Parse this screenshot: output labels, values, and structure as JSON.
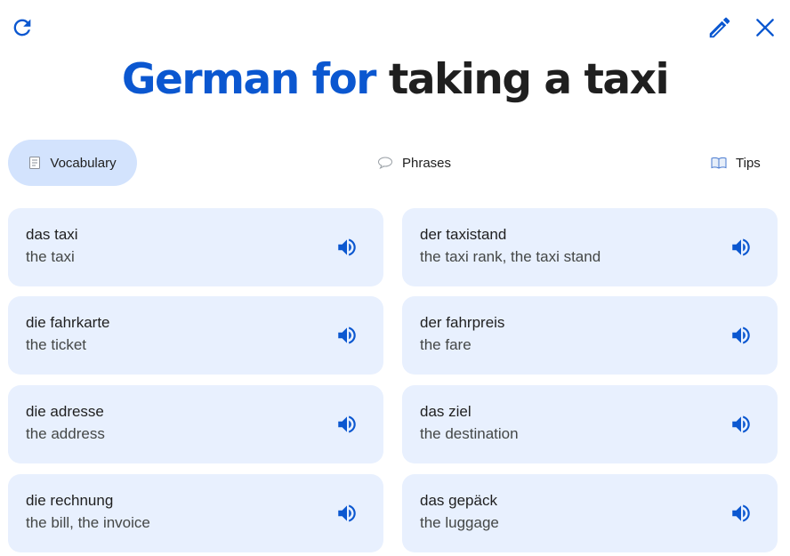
{
  "toolbar": {
    "refresh_icon": "refresh-icon",
    "edit_icon": "pencil-icon",
    "close_icon": "close-icon"
  },
  "title": {
    "accent": "German for",
    "rest": "taking a taxi"
  },
  "tabs": [
    {
      "label": "Vocabulary",
      "icon": "notepad-icon",
      "selected": true
    },
    {
      "label": "Phrases",
      "icon": "speech-bubble-icon",
      "selected": false
    },
    {
      "label": "Tips",
      "icon": "book-icon",
      "selected": false
    }
  ],
  "vocabulary": [
    {
      "word": "das taxi",
      "meaning": "the taxi"
    },
    {
      "word": "der taxistand",
      "meaning": "the taxi rank, the taxi stand"
    },
    {
      "word": "die fahrkarte",
      "meaning": "the ticket"
    },
    {
      "word": "der fahrpreis",
      "meaning": "the fare"
    },
    {
      "word": "die adresse",
      "meaning": "the address"
    },
    {
      "word": "das ziel",
      "meaning": "the destination"
    },
    {
      "word": "die rechnung",
      "meaning": "the bill, the invoice"
    },
    {
      "word": "das gepäck",
      "meaning": "the luggage"
    }
  ],
  "colors": {
    "accent": "#0b57d0",
    "card_background": "#e8f0fe",
    "selected_tab": "#d3e3fd"
  }
}
